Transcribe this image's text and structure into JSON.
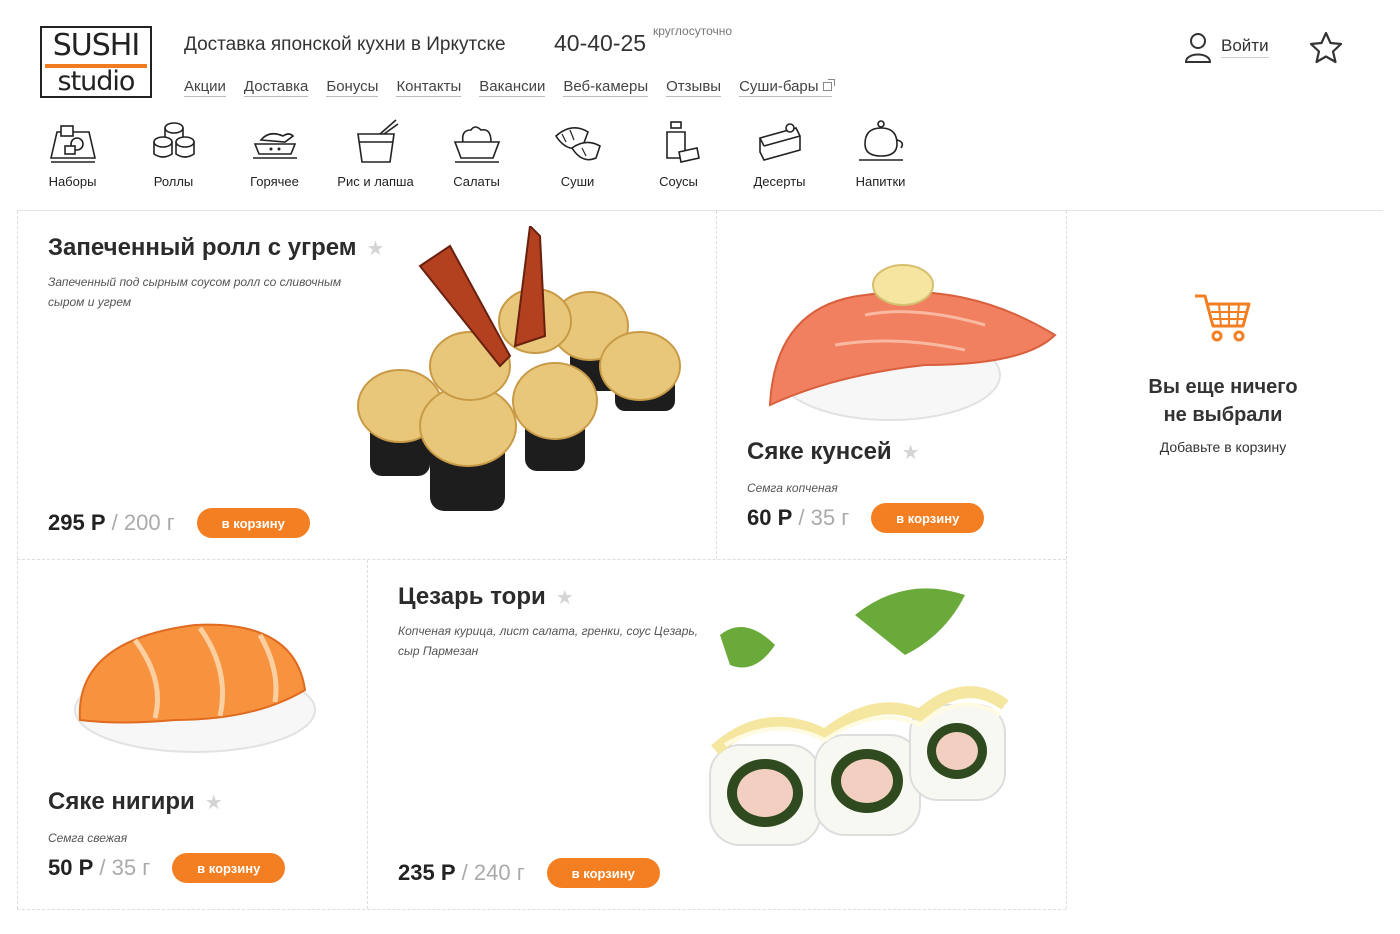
{
  "logo": {
    "top": "SUSHI",
    "bottom": "studio"
  },
  "header": {
    "tagline": "Доставка японской кухни в Иркутске",
    "phone": "40-40-25",
    "phone_note": "круглосуточно",
    "login_label": "Войти"
  },
  "topnav": [
    "Акции",
    "Доставка",
    "Бонусы",
    "Контакты",
    "Вакансии",
    "Веб-камеры",
    "Отзывы",
    "Суши-бары"
  ],
  "categories": [
    {
      "label": "Наборы",
      "icon": "sets-icon"
    },
    {
      "label": "Роллы",
      "icon": "rolls-icon"
    },
    {
      "label": "Горячее",
      "icon": "hot-dish-icon"
    },
    {
      "label": "Рис и лапша",
      "icon": "noodle-box-icon"
    },
    {
      "label": "Салаты",
      "icon": "salad-icon"
    },
    {
      "label": "Суши",
      "icon": "sushi-icon"
    },
    {
      "label": "Соусы",
      "icon": "sauce-icon"
    },
    {
      "label": "Десерты",
      "icon": "dessert-icon"
    },
    {
      "label": "Напитки",
      "icon": "teapot-icon"
    }
  ],
  "products": [
    {
      "title": "Запеченный ролл с угрем",
      "desc": "Запеченный под сырным соусом ролл со сливочным сыром и угрем",
      "price": "295 Р",
      "weight": "200 г",
      "button": "в корзину"
    },
    {
      "title": "Сяке кунсей",
      "desc": "Семга копченая",
      "price": "60 Р",
      "weight": "35 г",
      "button": "в корзину"
    },
    {
      "title": "Сяке нигири",
      "desc": "Семга свежая",
      "price": "50 Р",
      "weight": "35 г",
      "button": "в корзину"
    },
    {
      "title": "Цезарь тори",
      "desc": "Копченая курица, лист салата, гренки, соус Цезарь, сыр Пармезан",
      "price": "235 Р",
      "weight": "240 г",
      "button": "в корзину"
    }
  ],
  "cart": {
    "title_line1": "Вы еще ничего",
    "title_line2": "не выбрали",
    "subtitle": "Добавьте в корзину"
  },
  "colors": {
    "accent": "#f47f22",
    "text": "#2b2b2b"
  }
}
